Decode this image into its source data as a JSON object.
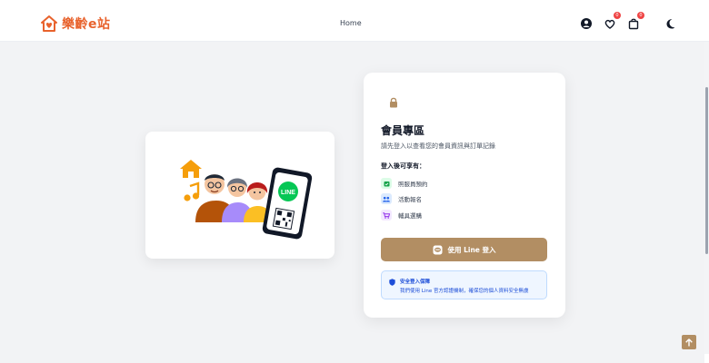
{
  "header": {
    "brand": "樂齡e站",
    "nav_home": "Home",
    "icons": [
      "user-icon",
      "heart-icon",
      "bag-icon",
      "moon-icon"
    ],
    "wishlist_badge": "0",
    "cart_badge": "0"
  },
  "illustration": {
    "line_label": "LINE"
  },
  "login": {
    "title": "會員專區",
    "description": "請先登入以查看您的會員資訊與訂單記錄",
    "benefits_title": "登入後可享有：",
    "benefits": [
      {
        "label": "照服員預約",
        "icon": "calendar-icon",
        "color": "#16a34a"
      },
      {
        "label": "活動報名",
        "icon": "group-icon",
        "color": "#2563eb"
      },
      {
        "label": "輔具選購",
        "icon": "cart-icon",
        "color": "#9333ea"
      }
    ],
    "line_button": "使用 Line 登入",
    "secure_title": "安全登入保障",
    "secure_text": "我們使用 Line 官方認證機制，確保您的個人資料安全無虞"
  },
  "colors": {
    "brand": "#e8622c",
    "accent": "#b28e63",
    "info": "#1d4ed8"
  }
}
